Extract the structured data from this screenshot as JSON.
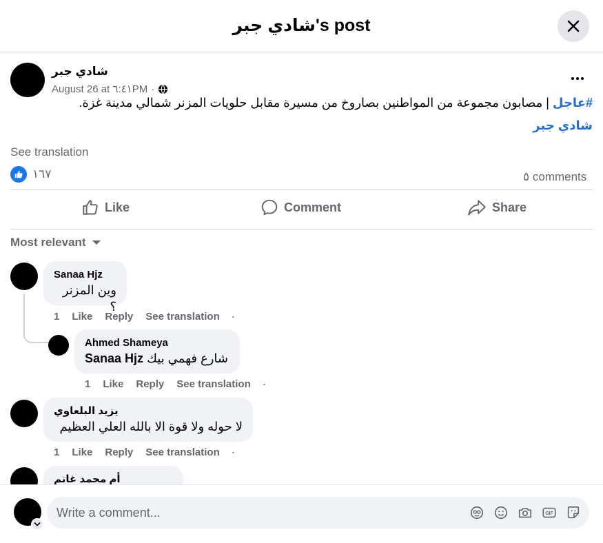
{
  "header": {
    "title": "شادي جبر's post"
  },
  "post": {
    "author": "شادي جبر",
    "meta_date": "August 26 at ٦:٤١PM",
    "meta_separator": "·",
    "hashtag": "#عاجل",
    "body": " | مصابون مجموعة من المواطنين بصاروخ من مسيرة مقابل حلويات المزنر شمالي مدينة غزة.",
    "mention": "شادي جبر",
    "see_translation": "See translation",
    "reaction_count": "١٦٧",
    "comments_count": "٥ comments"
  },
  "actions": {
    "like": "Like",
    "comment": "Comment",
    "share": "Share"
  },
  "sort_label": "Most relevant",
  "comments": [
    {
      "author": "Sanaa Hjz",
      "text": "وين المزنر ؟",
      "time": "1",
      "like": "Like",
      "reply": "Reply",
      "see_translation": "See translation",
      "dot": "·"
    },
    {
      "author": "Ahmed Shameya",
      "mention": "Sanaa Hjz",
      "text": "شارع فهمي بيك",
      "time": "1",
      "like": "Like",
      "reply": "Reply",
      "see_translation": "See translation",
      "dot": "·"
    },
    {
      "author": "يزيد البلعاوي",
      "text": "لا حوله ولا قوة الا بالله العلي العظيم",
      "time": "1",
      "like": "Like",
      "reply": "Reply",
      "see_translation": "See translation",
      "dot": "·"
    },
    {
      "author": "أم محمد غانم"
    }
  ],
  "composer": {
    "placeholder": "Write a comment..."
  },
  "colors": {
    "link": "#216fdb",
    "like_badge": "#1877f2",
    "bubble": "#f0f2f5",
    "muted": "#65676b"
  }
}
